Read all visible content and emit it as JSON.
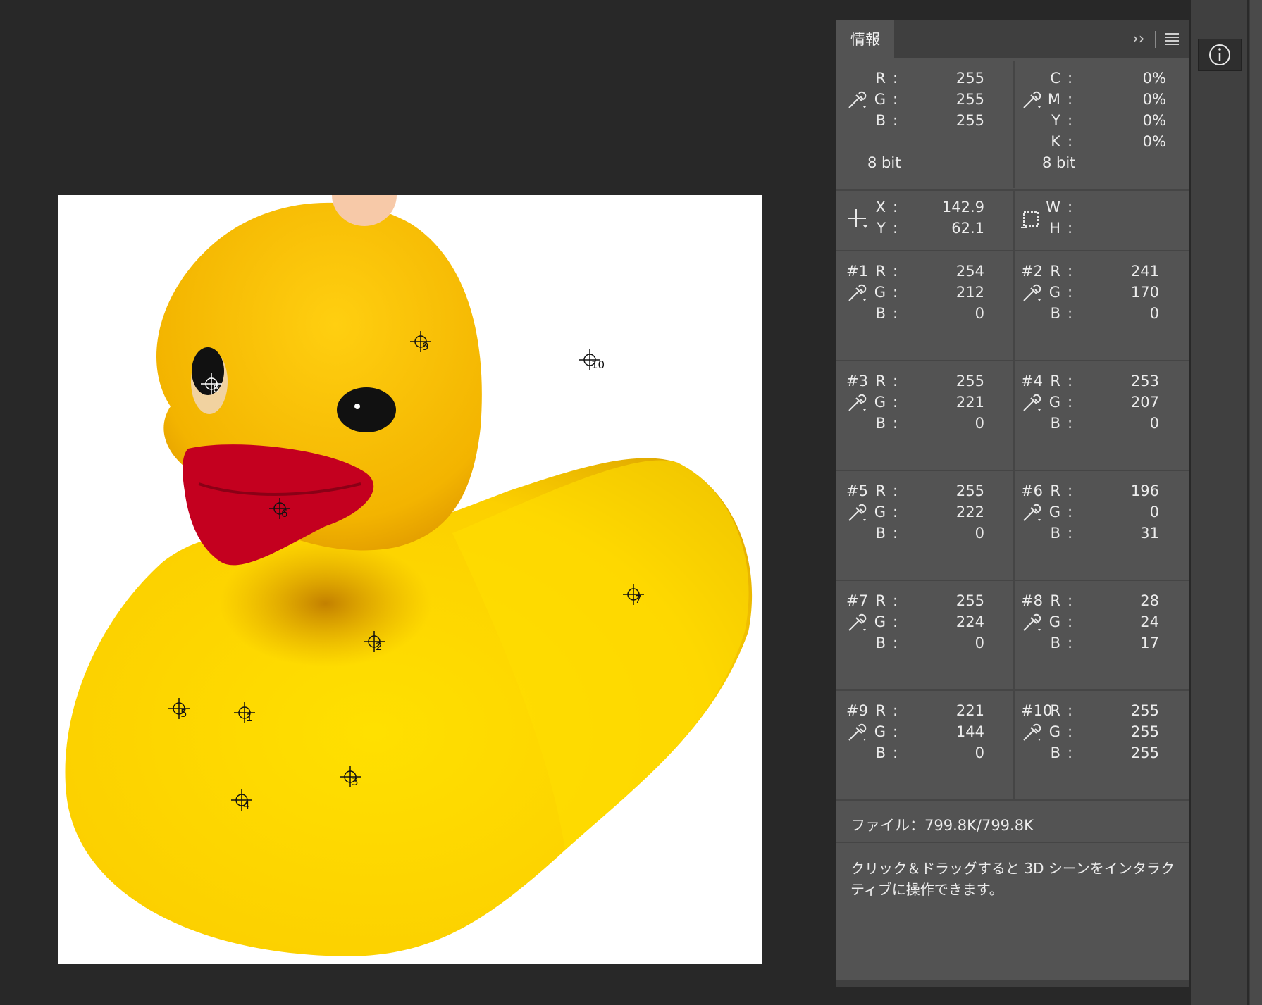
{
  "panel": {
    "tab_title": "情報"
  },
  "top": {
    "left": {
      "labels": [
        "R",
        "G",
        "B"
      ],
      "values": [
        "255",
        "255",
        "255"
      ],
      "bit": "8 bit"
    },
    "right": {
      "labels": [
        "C",
        "M",
        "Y",
        "K"
      ],
      "values": [
        "0%",
        "0%",
        "0%",
        "0%"
      ],
      "bit": "8 bit"
    }
  },
  "position": {
    "x_label": "X",
    "x_value": "142.9",
    "y_label": "Y",
    "y_value": "62.1",
    "w_label": "W",
    "h_label": "H"
  },
  "samples": [
    {
      "id": "#1",
      "r": "254",
      "g": "212",
      "b": "0"
    },
    {
      "id": "#2",
      "r": "241",
      "g": "170",
      "b": "0"
    },
    {
      "id": "#3",
      "r": "255",
      "g": "221",
      "b": "0"
    },
    {
      "id": "#4",
      "r": "253",
      "g": "207",
      "b": "0"
    },
    {
      "id": "#5",
      "r": "255",
      "g": "222",
      "b": "0"
    },
    {
      "id": "#6",
      "r": "196",
      "g": "0",
      "b": "31"
    },
    {
      "id": "#7",
      "r": "255",
      "g": "224",
      "b": "0"
    },
    {
      "id": "#8",
      "r": "28",
      "g": "24",
      "b": "17"
    },
    {
      "id": "#9",
      "r": "221",
      "g": "144",
      "b": "0"
    },
    {
      "id": "#10",
      "r": "255",
      "g": "255",
      "b": "255"
    }
  ],
  "channel_labels": {
    "r": "R",
    "g": "G",
    "b": "B"
  },
  "status": {
    "file": "ファイル：799.8K/799.8K"
  },
  "hint": "クリック＆ドラッグすると 3D シーンをインタラクティブに操作できます。",
  "markers": [
    "1",
    "2",
    "3",
    "4",
    "5",
    "6",
    "7",
    "8",
    "9",
    "10"
  ],
  "colors": {
    "duck_yellow": "#fcd000",
    "beak_red": "#c4001f",
    "panel_bg": "#535353",
    "canvas_bg": "#282828"
  }
}
